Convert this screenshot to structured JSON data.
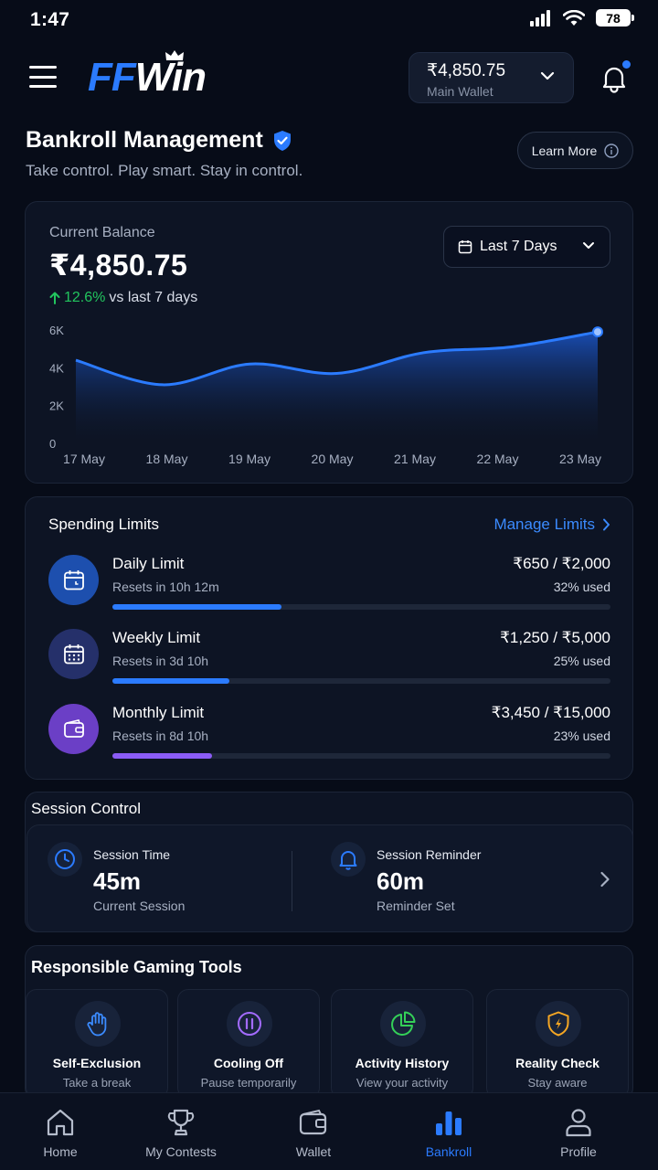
{
  "status_bar": {
    "time": "1:47",
    "battery": "78"
  },
  "header": {
    "logo_ff": "FF",
    "logo_win": "Win",
    "wallet_amount": "₹4,850.75",
    "wallet_label": "Main Wallet"
  },
  "page": {
    "title": "Bankroll Management",
    "subtitle": "Take control. Play smart. Stay in control.",
    "learn_more": "Learn More"
  },
  "balance": {
    "label": "Current Balance",
    "value": "₹4,850.75",
    "change": "12.6%",
    "change_suffix": "vs last 7 days",
    "range": "Last 7 Days"
  },
  "chart_data": {
    "type": "area",
    "x": [
      "17 May",
      "18 May",
      "19 May",
      "20 May",
      "21 May",
      "22 May",
      "23 May"
    ],
    "series": [
      {
        "values": [
          4400,
          3100,
          4200,
          3700,
          4800,
          5100,
          5900
        ]
      }
    ],
    "y_ticks": [
      "6K",
      "4K",
      "2K",
      "0"
    ],
    "ylim": [
      0,
      6000
    ],
    "grid": false,
    "color": "#2b7bff"
  },
  "limits": {
    "title": "Spending Limits",
    "manage": "Manage Limits",
    "items": [
      {
        "name": "Daily Limit",
        "reset": "Resets in 10h 12m",
        "amount": "₹650 / ₹2,000",
        "pct_label": "32% used",
        "pct": 0.34,
        "color": "#2b7bff",
        "icon_bg": "#1d4fae"
      },
      {
        "name": "Weekly Limit",
        "reset": "Resets in 3d 10h",
        "amount": "₹1,250 / ₹5,000",
        "pct_label": "25% used",
        "pct": 0.235,
        "color": "#2b7bff",
        "icon_bg": "#25306a"
      },
      {
        "name": "Monthly Limit",
        "reset": "Resets in 8d 10h",
        "amount": "₹3,450 / ₹15,000",
        "pct_label": "23% used",
        "pct": 0.2,
        "color": "#8b5cf6",
        "icon_bg": "#6b3fc6"
      }
    ]
  },
  "session": {
    "title": "Session Control",
    "time_label": "Session Time",
    "time_value": "45m",
    "time_sub": "Current Session",
    "reminder_label": "Session Reminder",
    "reminder_value": "60m",
    "reminder_sub": "Reminder Set"
  },
  "tools": {
    "title": "Responsible Gaming Tools",
    "items": [
      {
        "name": "Self-Exclusion",
        "sub": "Take a break",
        "icon": "hand-icon"
      },
      {
        "name": "Cooling Off",
        "sub": "Pause temporarily",
        "icon": "pause-icon"
      },
      {
        "name": "Activity History",
        "sub": "View your activity",
        "icon": "pie-chart-icon"
      },
      {
        "name": "Reality Check",
        "sub": "Stay aware",
        "icon": "shield-icon"
      }
    ]
  },
  "nav": {
    "items": [
      {
        "label": "Home",
        "icon": "home-icon"
      },
      {
        "label": "My Contests",
        "icon": "trophy-icon"
      },
      {
        "label": "Wallet",
        "icon": "wallet-icon"
      },
      {
        "label": "Bankroll",
        "icon": "bar-chart-icon",
        "active": true
      },
      {
        "label": "Profile",
        "icon": "user-icon"
      }
    ]
  }
}
